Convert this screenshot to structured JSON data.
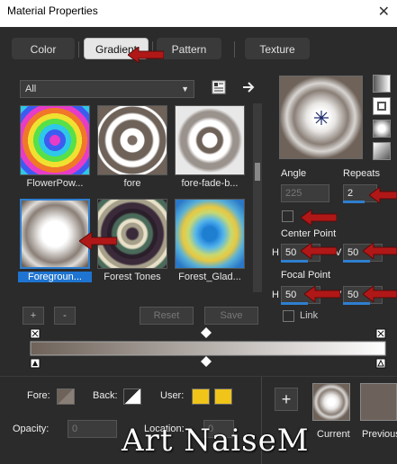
{
  "window": {
    "title": "Material Properties",
    "close_glyph": "✕"
  },
  "tabs": [
    {
      "label": "Color"
    },
    {
      "label": "Gradient"
    },
    {
      "label": "Pattern"
    },
    {
      "label": "Texture"
    }
  ],
  "category_select": {
    "value": "All"
  },
  "gradients": [
    {
      "label": "FlowerPow..."
    },
    {
      "label": "fore"
    },
    {
      "label": "fore-fade-b..."
    },
    {
      "label": "Foregroun...",
      "selected": true
    },
    {
      "label": "Forest Tones"
    },
    {
      "label": "Forest_Glad..."
    }
  ],
  "list_buttons": {
    "add": "+",
    "remove": "-",
    "reset": "Reset",
    "save": "Save"
  },
  "angle": {
    "label": "Angle",
    "value": "225"
  },
  "repeats": {
    "label": "Repeats",
    "value": "2"
  },
  "center_point": {
    "label": "Center Point",
    "h_label": "H",
    "h": "50",
    "v_label": "V",
    "v": "50"
  },
  "focal_point": {
    "label": "Focal Point",
    "h_label": "H",
    "h": "50",
    "v_label": "V",
    "v": "50"
  },
  "link": {
    "label": "Link"
  },
  "bottom": {
    "fore_label": "Fore:",
    "back_label": "Back:",
    "user_label": "User:",
    "opacity_label": "Opacity:",
    "opacity_value": "0",
    "location_label": "Location:",
    "location_value": "0",
    "add_glyph": "+",
    "current_label": "Current",
    "previous_label": "Previous"
  },
  "watermark": "Art NaiseM",
  "colors": {
    "accent": "#2f7fd0",
    "arrow": "#b01818",
    "user_swatch": "#f0c419",
    "previous_swatch": "#6d625b"
  }
}
